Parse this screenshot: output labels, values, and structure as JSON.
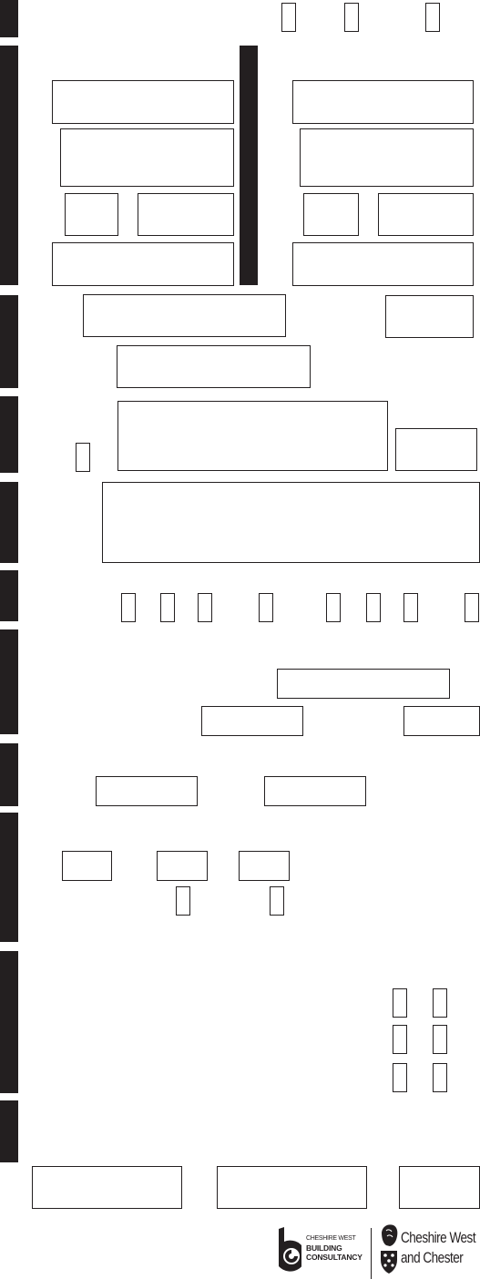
{
  "form": {
    "title": "",
    "section_count": 11,
    "colors": {
      "ink": "#231f20",
      "paper": "#ffffff"
    },
    "sections": [
      {
        "id": "section-1",
        "fields": [],
        "checkboxes": 3
      },
      {
        "id": "section-2",
        "columns": 2,
        "fields_per_column": 5
      },
      {
        "id": "section-3",
        "fields": 3
      },
      {
        "id": "section-4",
        "fields": 2,
        "checkboxes": 1
      },
      {
        "id": "section-5",
        "fields": 1
      },
      {
        "id": "section-6",
        "checkboxes": 8
      },
      {
        "id": "section-7",
        "fields": 3
      },
      {
        "id": "section-8",
        "fields": 2
      },
      {
        "id": "section-9",
        "fields": 3,
        "checkboxes": 2
      },
      {
        "id": "section-10",
        "checkboxes": 6
      },
      {
        "id": "section-11",
        "fields": 3
      }
    ]
  },
  "footer": {
    "logo_left": {
      "icon": "building-consultancy-b-icon",
      "line1": "CHESHIRE WEST",
      "line2": "BUILDING",
      "line3": "CONSULTANCY"
    },
    "logo_right": {
      "icon": "lion-crest-icon",
      "line1": "Cheshire West",
      "line2": "and Chester"
    }
  }
}
